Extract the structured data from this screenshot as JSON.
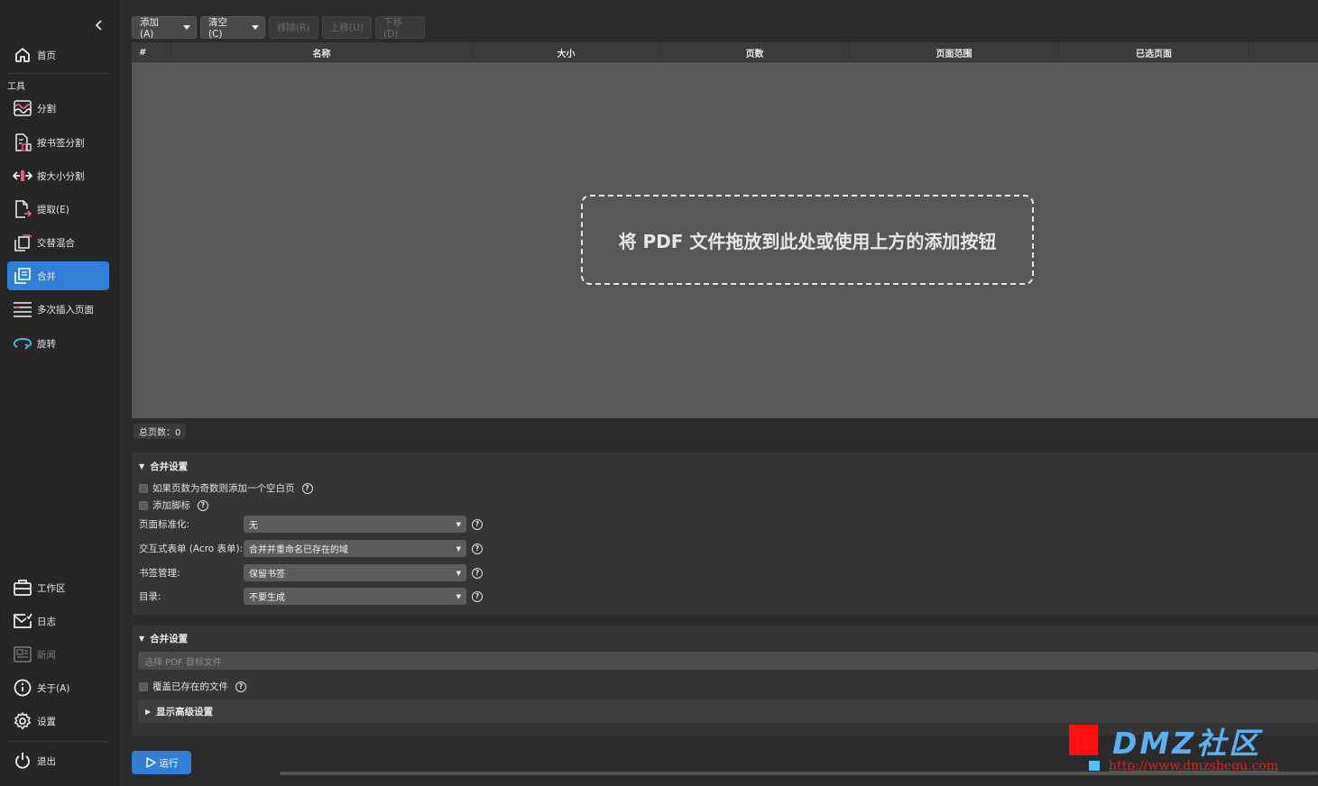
{
  "sidebar": {
    "home": "首页",
    "tools_section": "工具",
    "items": [
      {
        "label": "分割",
        "icon": "split-wave-icon"
      },
      {
        "label": "按书签分割",
        "icon": "bookmark-split-icon"
      },
      {
        "label": "按大小分割",
        "icon": "size-split-icon"
      },
      {
        "label": "提取(E)",
        "icon": "extract-icon"
      },
      {
        "label": "交替混合",
        "icon": "alternate-mix-icon"
      },
      {
        "label": "合并",
        "icon": "merge-icon"
      },
      {
        "label": "多次插入页面",
        "icon": "insert-pages-icon"
      },
      {
        "label": "旋转",
        "icon": "rotate-icon"
      }
    ],
    "active_item": "合并",
    "bottom": [
      {
        "label": "工作区",
        "icon": "workspace-icon"
      },
      {
        "label": "日志",
        "icon": "log-icon"
      },
      {
        "label": "新闻",
        "icon": "news-icon"
      },
      {
        "label": "关于(A)",
        "icon": "info-icon"
      },
      {
        "label": "设置",
        "icon": "gear-icon"
      }
    ],
    "exit": "退出"
  },
  "toolbar": {
    "add": "添加(A)",
    "clear": "清空(C)",
    "remove": "移除(R)",
    "move_up": "上移(U)",
    "move_down": "下移(D)"
  },
  "table": {
    "columns": [
      "#",
      "名称",
      "大小",
      "页数",
      "页面范围",
      "已选页面"
    ],
    "rows": []
  },
  "drop_zone_text": "将 PDF 文件拖放到此处或使用上方的添加按钮",
  "total_pages": "总页数：0",
  "merge_settings": {
    "title": "合并设置",
    "blank_page_if_odd": "如果页数为奇数则添加一个空白页",
    "add_footer": "添加脚标",
    "fields": [
      {
        "label": "页面标准化:",
        "value": "无"
      },
      {
        "label": "交互式表单 (Acro 表单):",
        "value": "合并并重命名已存在的域"
      },
      {
        "label": "书签管理:",
        "value": "保留书签"
      },
      {
        "label": "目录:",
        "value": "不要生成"
      }
    ]
  },
  "output_settings": {
    "title": "合并设置",
    "file_placeholder": "选择 PDF 目标文件",
    "overwrite": "覆盖已存在的文件",
    "advanced": "显示高级设置"
  },
  "run": "运行",
  "watermark": {
    "text": "DMZ社区",
    "url": "http://www.dmzshequ.com"
  },
  "colors": {
    "accent": "#2f7fd6",
    "watermark_red": "#ff1010",
    "watermark_blue": "#5cb0f0"
  }
}
